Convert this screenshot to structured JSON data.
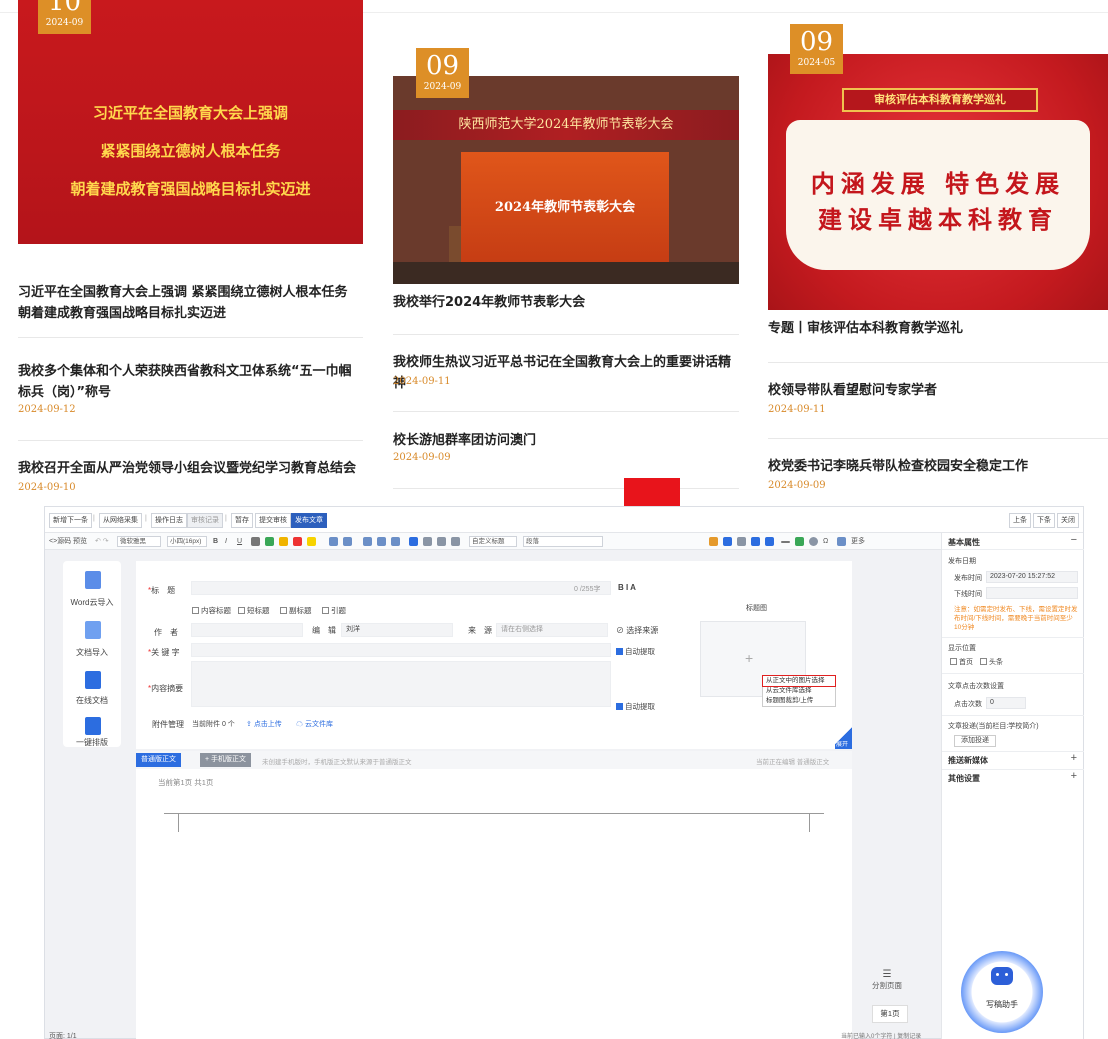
{
  "news": {
    "col1": {
      "feature": {
        "day": "10",
        "year_month": "2024-09",
        "image_lines": [
          "习近平在全国教育大会上强调",
          "紧紧围绕立德树人根本任务",
          "朝着建成教育强国战略目标扎实迈进"
        ],
        "title": "习近平在全国教育大会上强调 紧紧围绕立德树人根本任务 朝着建成教育强国战略目标扎实迈进"
      },
      "items": [
        {
          "title": "我校多个集体和个人荣获陕西省教科文卫体系统“五一巾帼标兵（岗）”称号",
          "date": "2024-09-12"
        },
        {
          "title": "我校召开全面从严治党领导小组会议暨党纪学习教育总结会",
          "date": "2024-09-10"
        }
      ]
    },
    "col2": {
      "feature": {
        "day": "09",
        "year_month": "2024-09",
        "image_banner": "陕西师范大学2024年教师节表彰大会",
        "image_screen": "2024年教师节表彰大会",
        "title": "我校举行2024年教师节表彰大会"
      },
      "items": [
        {
          "title": "我校师生热议习近平总书记在全国教育大会上的重要讲话精神",
          "date": "2024-09-11"
        },
        {
          "title": "校长游旭群率团访问澳门",
          "date": "2024-09-09"
        }
      ]
    },
    "col3": {
      "feature": {
        "day": "09",
        "year_month": "2024-05",
        "image_banner": "审核评估本科教育教学巡礼",
        "image_lines": [
          "内涵发展  特色发展",
          "建设卓越本科教育"
        ],
        "title": "专题丨审核评估本科教育教学巡礼"
      },
      "items": [
        {
          "title": "校领导带队看望慰问专家学者",
          "date": "2024-09-11"
        },
        {
          "title": "校党委书记李晓兵带队检查校园安全稳定工作",
          "date": "2024-09-09"
        }
      ]
    }
  },
  "editor": {
    "top_buttons": [
      "新增下一条",
      "从网络采集",
      "操作日志",
      "审核记录",
      "暂存",
      "提交审核",
      "发布文章"
    ],
    "nav_buttons": [
      "上条",
      "下条",
      "关闭"
    ],
    "format_bar": {
      "source": "<>源码",
      "preview": "预览",
      "font_family": "微软雅黑",
      "font_size": "小四(16px)",
      "bold": "B",
      "italic": "I",
      "underline": "U",
      "heading": "自定义标题",
      "paragraph": "段落",
      "more": "更多"
    },
    "left_rail": [
      "Word云导入",
      "文档导入",
      "在线文档",
      "一键排版"
    ],
    "form": {
      "title_label": "标　题",
      "title_counter": "0 /255字",
      "title_tools": "B I A",
      "checkboxes": [
        "内容标题",
        "短标题",
        "副标题",
        "引题"
      ],
      "author_label": "作　者",
      "editor_label": "编　辑",
      "editor_value": "刘洋",
      "source_label": "来　源",
      "source_placeholder": "请在右侧选择",
      "choose_source": "选择来源",
      "keyword_label": "关 键 字",
      "auto_extract_1": "自动提取",
      "summary_label": "内容摘要",
      "auto_extract_2": "自动提取",
      "attach_label": "附件管理",
      "attach_count": "当前附件 0 个",
      "upload": "点击上传",
      "cloud_lib": "云文件库",
      "thumb_title": "标题图",
      "thumb_plus": "+",
      "thumb_menu": [
        "从正文中的图片选择",
        "从云文件库选择",
        "标题图裁剪/上传"
      ],
      "expand": "展开"
    },
    "tabs": {
      "normal": "普通版正文",
      "mobile": "+ 手机版正文",
      "note": "未创建手机版时，手机版正文默认来源于普通版正文",
      "right_note": "当前正在编辑  普通版正文"
    },
    "doc": {
      "page_count": "当前第1页 共1页",
      "split_page": "分割页面",
      "page1": "第1页"
    },
    "status_left": "页面: 1/1",
    "status_right": "当前已输入0个字符 | 复制记录",
    "right_panel": {
      "basic_props": "基本属性",
      "collapse": "−",
      "publish_date": "发布日期",
      "publish_time_label": "发布时间",
      "publish_time_value": "2023-07-20 15:27:52",
      "offline_label": "下线时间",
      "warning": "注意：如需定时发布、下线，需设置定时发布时间/下线时间，需要晚于当前时间至少10分钟",
      "display_pos": "显示位置",
      "home": "首页",
      "headline": "头条",
      "click_settings": "文章点击次数设置",
      "click_label": "点击次数",
      "click_value": "0",
      "push": "文章投递(当前栏目:学校简介)",
      "add_push": "添加投递",
      "push_media": "推送新媒体",
      "other_settings": "其他设置",
      "plus": "+",
      "assistant": "写稿助手"
    }
  },
  "colors": {
    "date_tag": "#dd8f27",
    "date_text": "#d88a2a",
    "primary_blue": "#2c6de0",
    "publish_blue": "#2c5fbd",
    "arrow_red": "#e8141b"
  }
}
